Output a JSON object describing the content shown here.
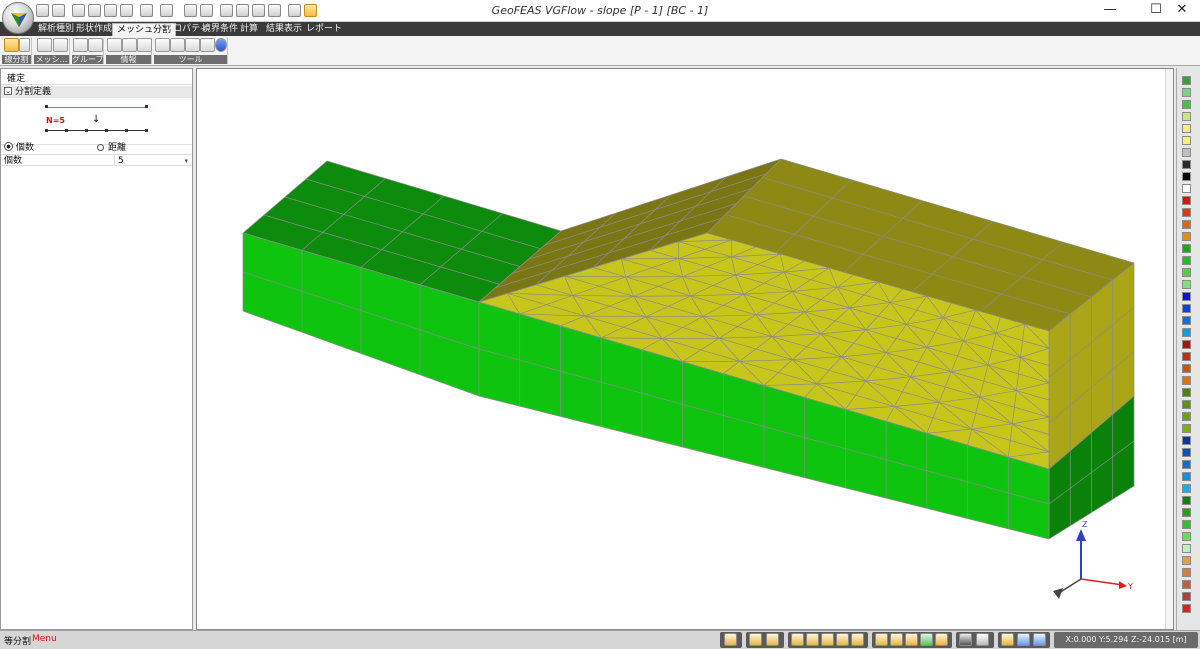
{
  "window": {
    "title": "GeoFEAS VGFlow - slope [P - 1] [BC - 1]",
    "minimize": "—",
    "maximize": "☐",
    "close": "✕"
  },
  "tabs": [
    "解析種別",
    "形状作成",
    "メッシュ分割",
    "プロパティ",
    "境界条件",
    "計算",
    "結果表示",
    "レポート"
  ],
  "active_tab": "メッシュ分割",
  "ribbon_groups": [
    {
      "label": "線分割"
    },
    {
      "label": "メッシ..."
    },
    {
      "label": "グループ"
    },
    {
      "label": "情報"
    },
    {
      "label": "ツール"
    }
  ],
  "panel": {
    "confirm": "確定",
    "section_title": "分割定義",
    "diagram_label": "N=5",
    "radio_count": "個数",
    "radio_distance": "距離",
    "field_label": "個数",
    "field_value": "5"
  },
  "axes": {
    "z": "Z",
    "y": "Y",
    "x": "X"
  },
  "status": {
    "mode": "等分割",
    "menu": "Menu",
    "coords": "X:0.000 Y:5.294 Z:-24.015 [m]"
  },
  "colors": {
    "top_dark_green": "#0d8b0d",
    "side_green": "#0fc40f",
    "slope_olive": "#8d8914",
    "slope_face": "#c8c51a",
    "end_face": "#a9a516",
    "end_bottom": "#0a820a",
    "palette": [
      "#3b9e3b",
      "#7ed37e",
      "#48c048",
      "#c6e878",
      "#f2f27a",
      "#f2f27a",
      "#bfbfbf",
      "#2b2b2b",
      "#000000",
      "#ffffff",
      "#e01010",
      "#e03a10",
      "#e06510",
      "#e09010",
      "#10b010",
      "#20c020",
      "#50d050",
      "#80e080",
      "#1010e0",
      "#1040e0",
      "#1070e0",
      "#10a0e0",
      "#b01010",
      "#c03010",
      "#d05010",
      "#e07010",
      "#508010",
      "#609010",
      "#70a010",
      "#80b010",
      "#1030b0",
      "#1050c0",
      "#1070d0",
      "#1090e0",
      "#10b0f0",
      "#108010",
      "#20a020",
      "#30c030",
      "#60e060",
      "#c0f0c0",
      "#e0a040",
      "#d08040",
      "#c06040",
      "#b04040",
      "#e02020"
    ]
  }
}
